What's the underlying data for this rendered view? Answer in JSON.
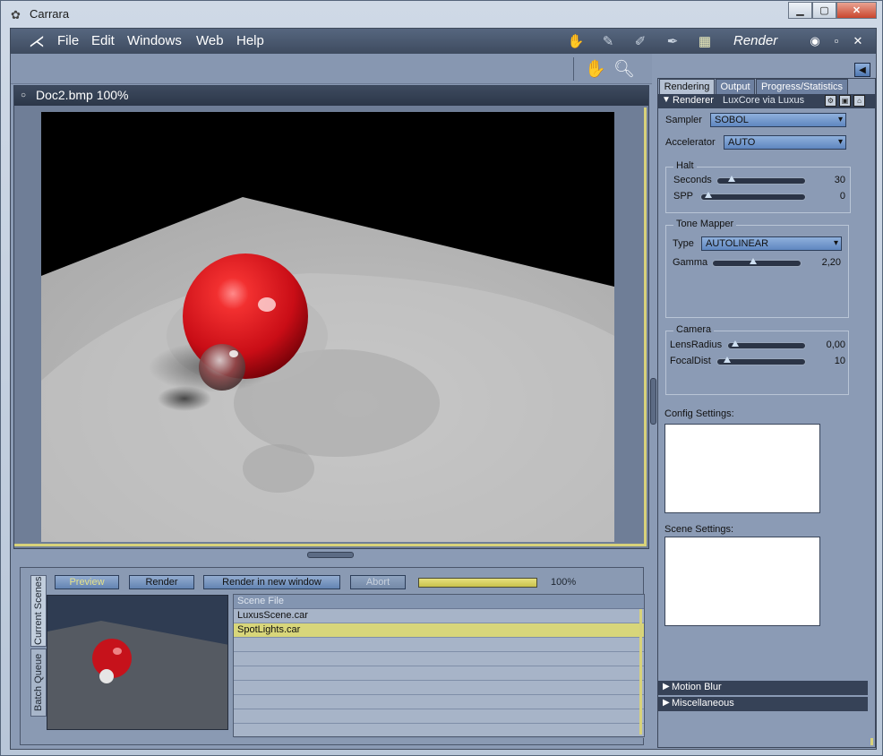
{
  "window": {
    "title": "Carrara"
  },
  "menu": {
    "items": [
      "File",
      "Edit",
      "Windows",
      "Web",
      "Help"
    ],
    "room": "Render"
  },
  "document": {
    "title": "Doc2.bmp 100%"
  },
  "bottom": {
    "tabs": [
      "Current Scenes",
      "Batch Queue"
    ],
    "buttons": {
      "preview": "Preview",
      "render": "Render",
      "render_new": "Render in new window",
      "abort": "Abort"
    },
    "progress": {
      "value": 100,
      "label": "100%"
    },
    "scene_list": {
      "header": "Scene File",
      "rows": [
        "LuxusScene.car",
        "SpotLights.car",
        "",
        "",
        "",
        "",
        "",
        "",
        ""
      ]
    }
  },
  "rpanel": {
    "tabs": [
      "Rendering",
      "Output",
      "Progress/Statistics"
    ],
    "renderer": {
      "label": "Renderer",
      "value": "LuxCore via Luxus"
    },
    "sampler": {
      "label": "Sampler",
      "value": "SOBOL"
    },
    "accelerator": {
      "label": "Accelerator",
      "value": "AUTO"
    },
    "halt": {
      "title": "Halt",
      "seconds": {
        "label": "Seconds",
        "value": "30",
        "level": 0.1
      },
      "spp": {
        "label": "SPP",
        "value": "0",
        "level": 0.0
      }
    },
    "tonemapper": {
      "title": "Tone Mapper",
      "type": {
        "label": "Type",
        "value": "AUTOLINEAR"
      },
      "gamma": {
        "label": "Gamma",
        "value": "2,20",
        "level": 0.44
      }
    },
    "camera": {
      "title": "Camera",
      "lensradius": {
        "label": "LensRadius",
        "value": "0,00",
        "level": 0.0
      },
      "focaldist": {
        "label": "FocalDist",
        "value": "10",
        "level": 0.03
      }
    },
    "config_label": "Config Settings:",
    "scene_label": "Scene Settings:",
    "sections": [
      "Motion Blur",
      "Miscellaneous"
    ]
  },
  "colors": {
    "accent_yellow": "#d8d27a",
    "sphere_red": "#d8141c",
    "panel_bg": "#8b9bb5"
  }
}
